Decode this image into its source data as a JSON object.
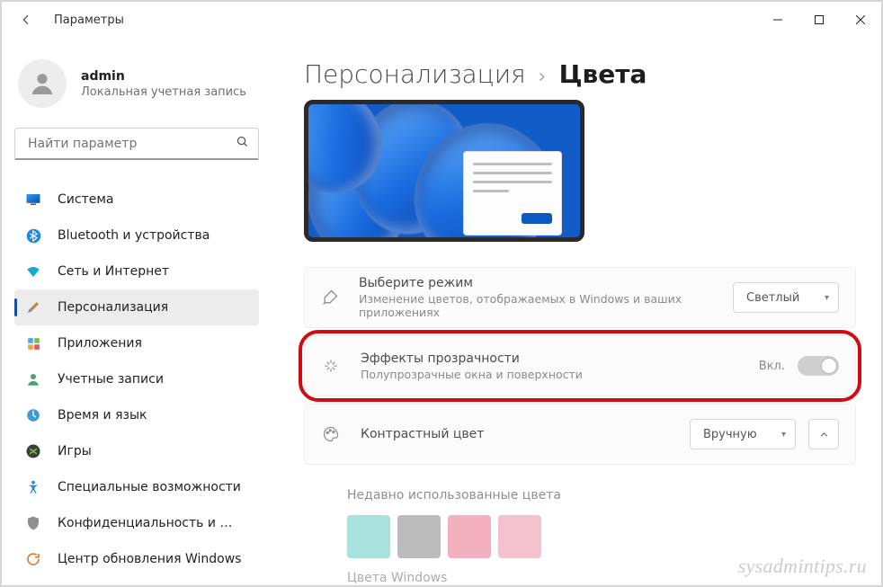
{
  "window": {
    "title": "Параметры"
  },
  "user": {
    "name": "admin",
    "account_type": "Локальная учетная запись"
  },
  "search": {
    "placeholder": "Найти параметр"
  },
  "nav": [
    {
      "id": "system",
      "label": "Система"
    },
    {
      "id": "bluetooth",
      "label": "Bluetooth и устройства"
    },
    {
      "id": "network",
      "label": "Сеть и Интернет"
    },
    {
      "id": "personalize",
      "label": "Персонализация",
      "active": true
    },
    {
      "id": "apps",
      "label": "Приложения"
    },
    {
      "id": "accounts",
      "label": "Учетные записи"
    },
    {
      "id": "time",
      "label": "Время и язык"
    },
    {
      "id": "gaming",
      "label": "Игры"
    },
    {
      "id": "accessibility",
      "label": "Специальные возможности"
    },
    {
      "id": "privacy",
      "label": "Конфиденциальность и безопасность"
    },
    {
      "id": "update",
      "label": "Центр обновления Windows"
    }
  ],
  "breadcrumb": {
    "parent": "Персонализация",
    "sep": "›",
    "current": "Цвета"
  },
  "rows": {
    "mode": {
      "title": "Выберите режим",
      "subtitle": "Изменение цветов, отображаемых в Windows и ваших приложениях",
      "value": "Светлый"
    },
    "transparency": {
      "title": "Эффекты прозрачности",
      "subtitle": "Полупрозрачные окна и поверхности",
      "state_label": "Вкл."
    },
    "accent": {
      "title": "Контрастный цвет",
      "value": "Вручную"
    }
  },
  "recent_colors": {
    "heading": "Недавно использованные цвета",
    "swatches": [
      "#a8e2dd",
      "#bcbcbc",
      "#f3b0bf",
      "#f4c2cd"
    ]
  },
  "windows_colors_heading": "Цвета Windows",
  "watermark": "sysadmintips.ru"
}
